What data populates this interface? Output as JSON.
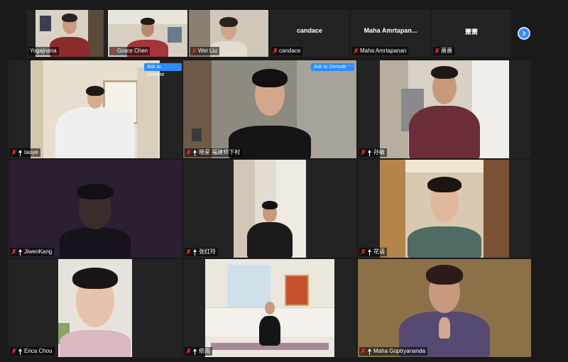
{
  "strip": [
    {
      "name": "Yogajnana",
      "video": true
    },
    {
      "name": "Grace Chen",
      "video": true
    },
    {
      "name": "Wei Liu",
      "video": true
    },
    {
      "name": "candace",
      "video": false,
      "display_name": "candace"
    },
    {
      "name": "Maha Amrtapanan",
      "video": false,
      "display_name": "Maha Amrtapan..."
    },
    {
      "name": "萧萧",
      "video": false,
      "display_name": "萧萧"
    }
  ],
  "tiles": [
    {
      "name": "taoye"
    },
    {
      "name": "晓星 福建师下村"
    },
    {
      "name": "孙敏"
    },
    {
      "name": "JiwenKang"
    },
    {
      "name": "张红玲"
    },
    {
      "name": "花语"
    },
    {
      "name": "Erica Chou"
    },
    {
      "name": "依雨"
    },
    {
      "name": "Maha Goptryananda"
    }
  ],
  "buttons": {
    "ask_to_unmute": "Ask to Unmute",
    "more": "···"
  },
  "icons": {
    "mic": "muted-mic-icon",
    "pin": "spotlight-pin-icon",
    "next": "chevron-right-icon"
  },
  "colors": {
    "background": "#1a1a1a",
    "tile": "#232323",
    "accent": "#2d8cff",
    "muted_red": "#e02828"
  }
}
